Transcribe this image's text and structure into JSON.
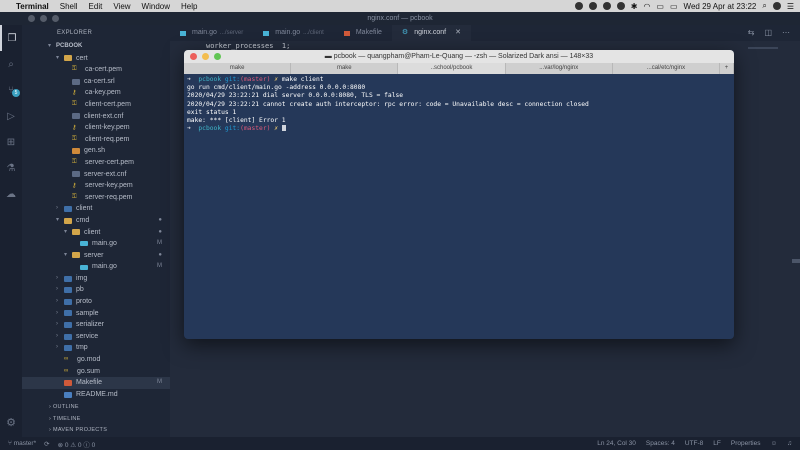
{
  "menubar": {
    "app_name": "Terminal",
    "items": [
      "Shell",
      "Edit",
      "View",
      "Window",
      "Help"
    ],
    "clock": "Wed 29 Apr at 23:22"
  },
  "window": {
    "title": "nginx.conf — pcbook"
  },
  "sidebar": {
    "header": "EXPLORER",
    "project": "PCBOOK",
    "tree": [
      {
        "label": "cert",
        "type": "folder-open",
        "depth": 1
      },
      {
        "label": "ca-cert.pem",
        "type": "pem",
        "depth": 2
      },
      {
        "label": "ca-cert.srl",
        "type": "cnf",
        "depth": 2
      },
      {
        "label": "ca-key.pem",
        "type": "key",
        "depth": 2
      },
      {
        "label": "client-cert.pem",
        "type": "pem",
        "depth": 2
      },
      {
        "label": "client-ext.cnf",
        "type": "cnf",
        "depth": 2
      },
      {
        "label": "client-key.pem",
        "type": "key",
        "depth": 2
      },
      {
        "label": "client-req.pem",
        "type": "pem",
        "depth": 2
      },
      {
        "label": "gen.sh",
        "type": "sh",
        "depth": 2
      },
      {
        "label": "server-cert.pem",
        "type": "pem",
        "depth": 2
      },
      {
        "label": "server-ext.cnf",
        "type": "cnf",
        "depth": 2
      },
      {
        "label": "server-key.pem",
        "type": "key",
        "depth": 2
      },
      {
        "label": "server-req.pem",
        "type": "pem",
        "depth": 2
      },
      {
        "label": "client",
        "type": "folder",
        "depth": 1
      },
      {
        "label": "cmd",
        "type": "folder-open",
        "depth": 1,
        "flag": "●"
      },
      {
        "label": "client",
        "type": "folder-open",
        "depth": 2,
        "flag": "●"
      },
      {
        "label": "main.go",
        "type": "go",
        "depth": 3,
        "flag": "M"
      },
      {
        "label": "server",
        "type": "folder-open",
        "depth": 2,
        "flag": "●"
      },
      {
        "label": "main.go",
        "type": "go",
        "depth": 3,
        "flag": "M"
      },
      {
        "label": "img",
        "type": "folder",
        "depth": 1
      },
      {
        "label": "pb",
        "type": "folder",
        "depth": 1
      },
      {
        "label": "proto",
        "type": "folder",
        "depth": 1
      },
      {
        "label": "sample",
        "type": "folder",
        "depth": 1
      },
      {
        "label": "serializer",
        "type": "folder",
        "depth": 1
      },
      {
        "label": "service",
        "type": "folder",
        "depth": 1
      },
      {
        "label": "tmp",
        "type": "folder",
        "depth": 1
      },
      {
        "label": "go.mod",
        "type": "mod",
        "depth": 1
      },
      {
        "label": "go.sum",
        "type": "mod",
        "depth": 1
      },
      {
        "label": "Makefile",
        "type": "mk",
        "depth": 1,
        "flag": "M",
        "selected": true
      },
      {
        "label": "README.md",
        "type": "md",
        "depth": 1
      }
    ],
    "sections": [
      "OUTLINE",
      "TIMELINE",
      "MAVEN PROJECTS"
    ]
  },
  "editor": {
    "tabs": [
      {
        "label": "main.go",
        "sub": ".../server",
        "icon": "go"
      },
      {
        "label": "main.go",
        "sub": ".../client",
        "icon": "go"
      },
      {
        "label": "Makefile",
        "sub": "",
        "icon": "mk"
      },
      {
        "label": "nginx.conf",
        "sub": "",
        "icon": "gear",
        "active": true,
        "close": "✕"
      }
    ],
    "visible_code": "worker_processes  1;"
  },
  "terminal": {
    "title": "pcbook — quangpham@Pham-Le-Quang — -zsh — Solarized Dark ansi — 148×33",
    "tabs": [
      "make",
      "make",
      "..school/pcbook",
      "...var/log/nginx",
      "...cal/etc/nginx"
    ],
    "plus_tab": "+",
    "lines": [
      {
        "kind": "prompt",
        "dir": "pcbook",
        "git": "git:",
        "branch": "(master)",
        "mark": "✗",
        "cmd": "make client"
      },
      {
        "kind": "out",
        "text": "go run cmd/client/main.go -address 0.0.0.0:8080"
      },
      {
        "kind": "out",
        "text": "2020/04/29 23:22:21 dial server 0.0.0.0:8080, TLS = false"
      },
      {
        "kind": "out",
        "text": "2020/04/29 23:22:21 cannot create auth interceptor: rpc error: code = Unavailable desc = connection closed"
      },
      {
        "kind": "out",
        "text": "exit status 1"
      },
      {
        "kind": "out",
        "text": "make: *** [client] Error 1"
      },
      {
        "kind": "prompt",
        "dir": "pcbook",
        "git": "git:",
        "branch": "(master)",
        "mark": "✗",
        "cmd": ""
      }
    ]
  },
  "statusbar": {
    "branch": "master*",
    "errors": "0",
    "warnings": "0",
    "info": "0",
    "position": "Ln 24, Col 30",
    "spaces": "Spaces: 4",
    "encoding": "UTF-8",
    "eol": "LF",
    "language": "Properties"
  }
}
